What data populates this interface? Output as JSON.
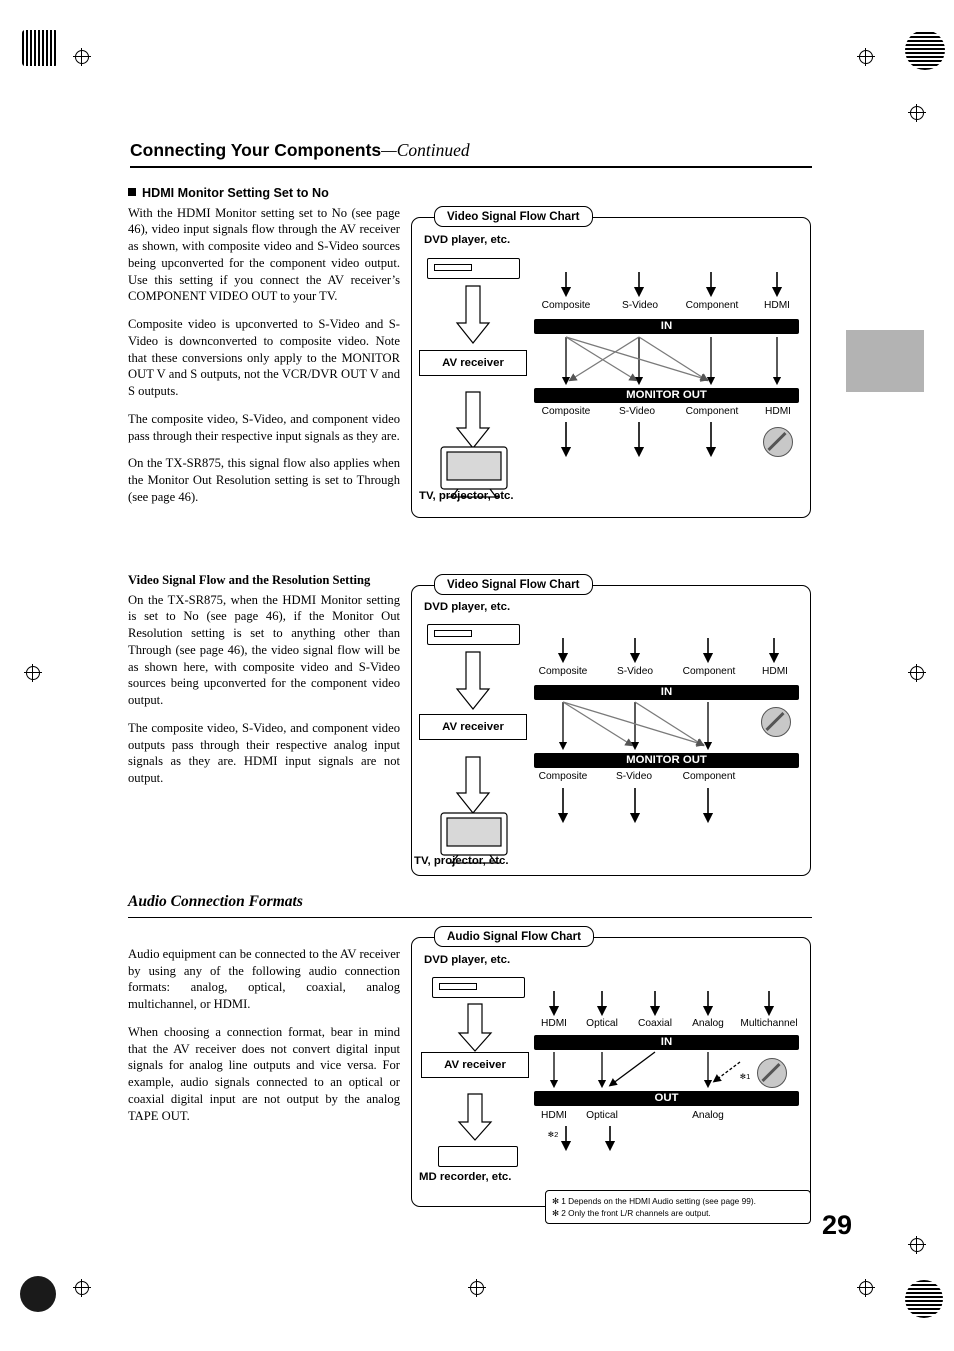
{
  "header": {
    "title_main": "Connecting Your Components",
    "title_cont": "—Continued"
  },
  "page_number": "29",
  "section1": {
    "heading": "HDMI Monitor Setting Set to No",
    "paragraphs": [
      "With the HDMI Monitor setting set to No (see page 46), video input signals flow through the AV receiver as shown, with composite video and S-Video sources being upconverted for the component video output. Use this setting if you connect the AV receiver’s COMPONENT VIDEO OUT to your TV.",
      "Composite video is upconverted to S-Video and S-Video is downconverted to composite video. Note that these conversions only apply to the MONITOR OUT V and S outputs, not the VCR/DVR OUT V and S outputs.",
      "The composite video, S-Video, and component video pass through their respective input signals as they are.",
      "On the TX-SR875, this signal flow also applies when the Monitor Out Resolution setting is set to Through (see page 46)."
    ]
  },
  "section2": {
    "heading": "Video Signal Flow and the Resolution Setting",
    "paragraphs": [
      "On the TX-SR875, when the HDMI Monitor setting is set to No (see page 46), if the Monitor Out Resolution setting is set to anything other than Through (see page 46), the video signal flow will be as shown here, with composite video and S-Video sources being upconverted for the component video output.",
      "The composite video, S-Video, and component video outputs pass through their respective analog input signals as they are. HDMI input signals are not output."
    ]
  },
  "section3": {
    "heading": "Audio Connection Formats",
    "paragraphs": [
      "Audio equipment can be connected to the AV receiver by using any of the following audio connection formats: analog, optical, coaxial, analog multichannel, or HDMI.",
      "When choosing a connection format, bear in mind that the AV receiver does not convert digital input signals for analog line outputs and vice versa. For example, audio signals connected to an optical or coaxial digital input are not output by the analog TAPE OUT."
    ]
  },
  "chart1": {
    "title": "Video Signal Flow Chart",
    "source_label": "DVD player, etc.",
    "receiver_label": "AV receiver",
    "tv_label": "TV, projector, etc.",
    "in_bar": "IN",
    "out_bar": "MONITOR OUT",
    "in_ports": [
      "Composite",
      "S-Video",
      "Component",
      "HDMI"
    ],
    "out_ports": [
      "Composite",
      "S-Video",
      "Component",
      "HDMI"
    ]
  },
  "chart2": {
    "title": "Video Signal Flow Chart",
    "source_label": "DVD player, etc.",
    "receiver_label": "AV receiver",
    "tv_label": "TV, projector, etc.",
    "in_bar": "IN",
    "out_bar": "MONITOR OUT",
    "in_ports": [
      "Composite",
      "S-Video",
      "Component",
      "HDMI"
    ],
    "out_ports": [
      "Composite",
      "S-Video",
      "Component"
    ]
  },
  "chart3": {
    "title": "Audio Signal Flow Chart",
    "source_label": "DVD player, etc.",
    "receiver_label": "AV receiver",
    "recorder_label": "MD recorder, etc.",
    "in_bar": "IN",
    "out_bar": "OUT",
    "in_ports": [
      "HDMI",
      "Optical",
      "Coaxial",
      "Analog",
      "Multichannel"
    ],
    "out_ports": [
      "HDMI",
      "Optical",
      "Analog"
    ],
    "mark1": "✻1",
    "mark2": "✻2",
    "notes": [
      "✻ 1  Depends on the HDMI Audio setting (see page 99).",
      "✻ 2  Only the front L/R channels are output."
    ]
  }
}
